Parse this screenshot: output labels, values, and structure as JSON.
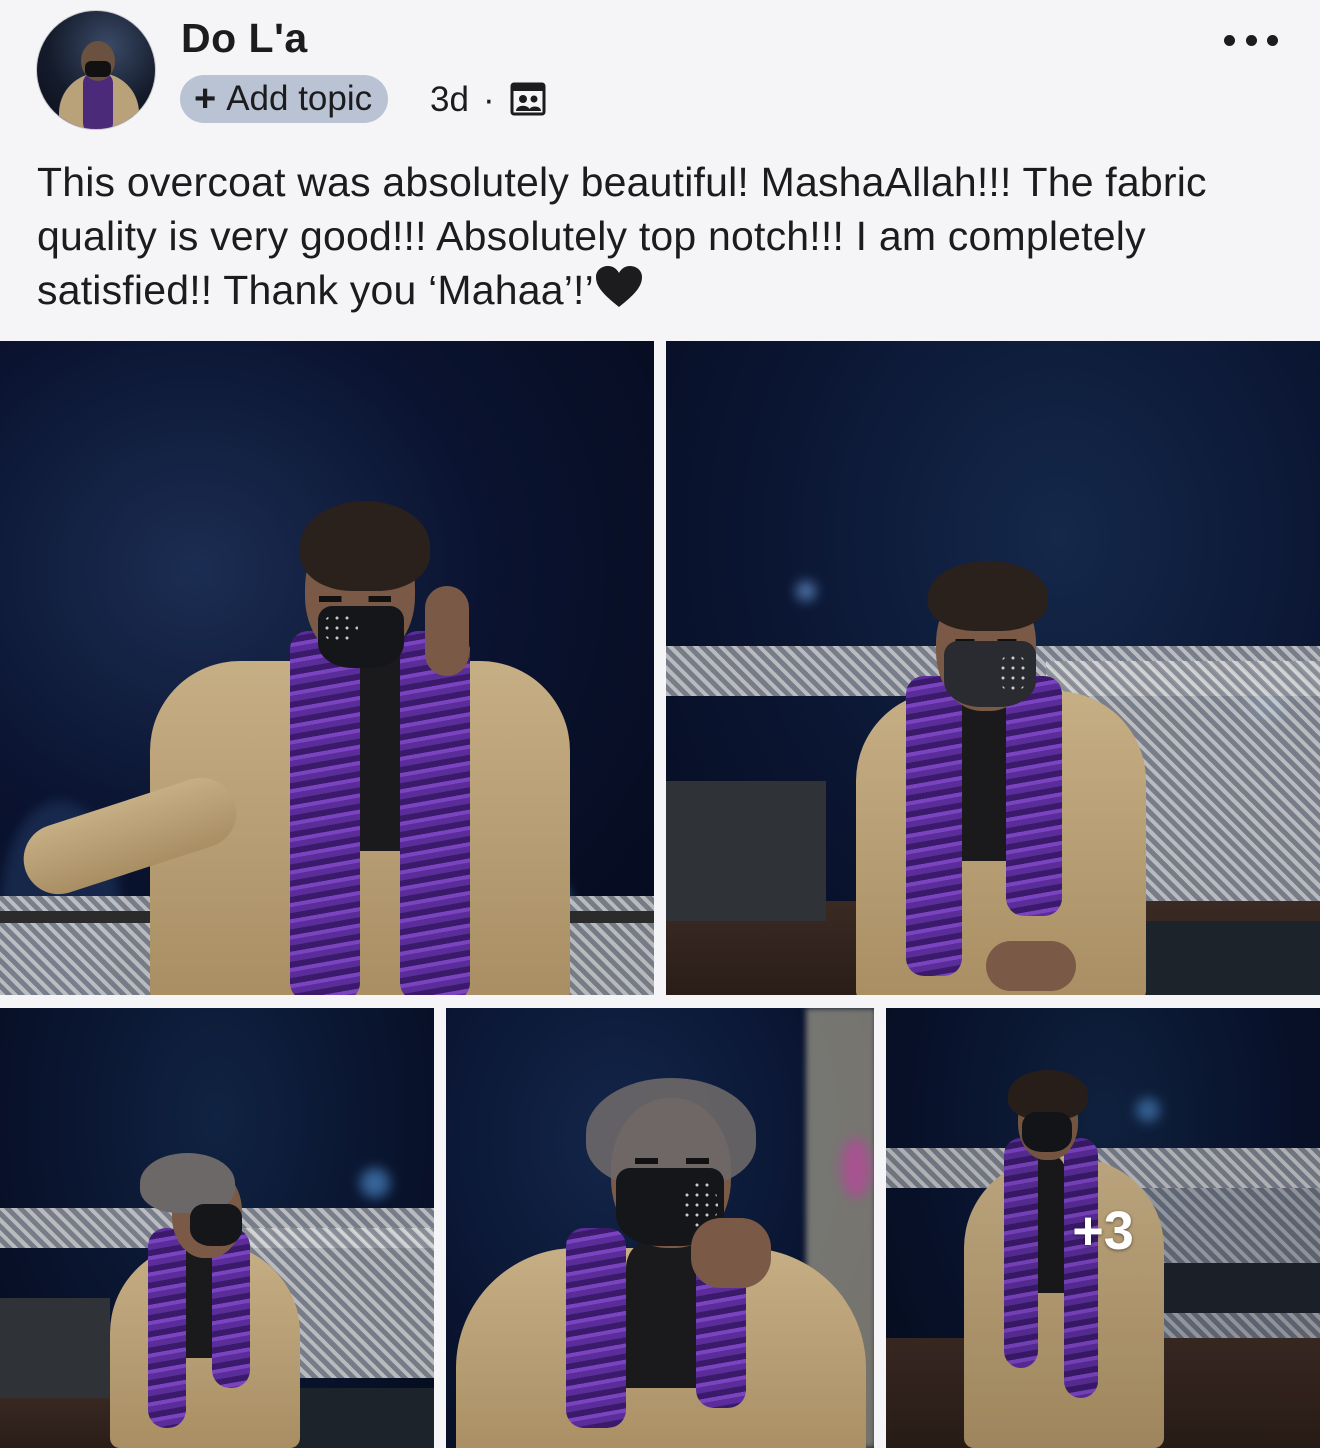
{
  "author": {
    "name": "Do L'a",
    "avatar_icon": "profile-photo"
  },
  "meta": {
    "add_topic_label": "Add topic",
    "add_topic_icon": "plus-icon",
    "time": "3d",
    "separator": "·",
    "audience_icon": "custom-audience-icon"
  },
  "menu": {
    "more_icon": "more-horizontal-icon"
  },
  "caption": {
    "text": "This overcoat was absolutely beautiful! MashaAllah!!! The fabric quality is very good!!! Absolutely top notch!!! I am completely satisfied!! Thank you ‘Mahaa’!’",
    "emoji": "black-heart-icon"
  },
  "photos": {
    "count_visible": 5,
    "more_label": "+3"
  },
  "colors": {
    "background": "#f5f5f7",
    "add_topic_bg": "#b9c3d3",
    "text": "#1c1c1e",
    "scarf": "#5b2d9a",
    "coat": "#c6ae85"
  }
}
